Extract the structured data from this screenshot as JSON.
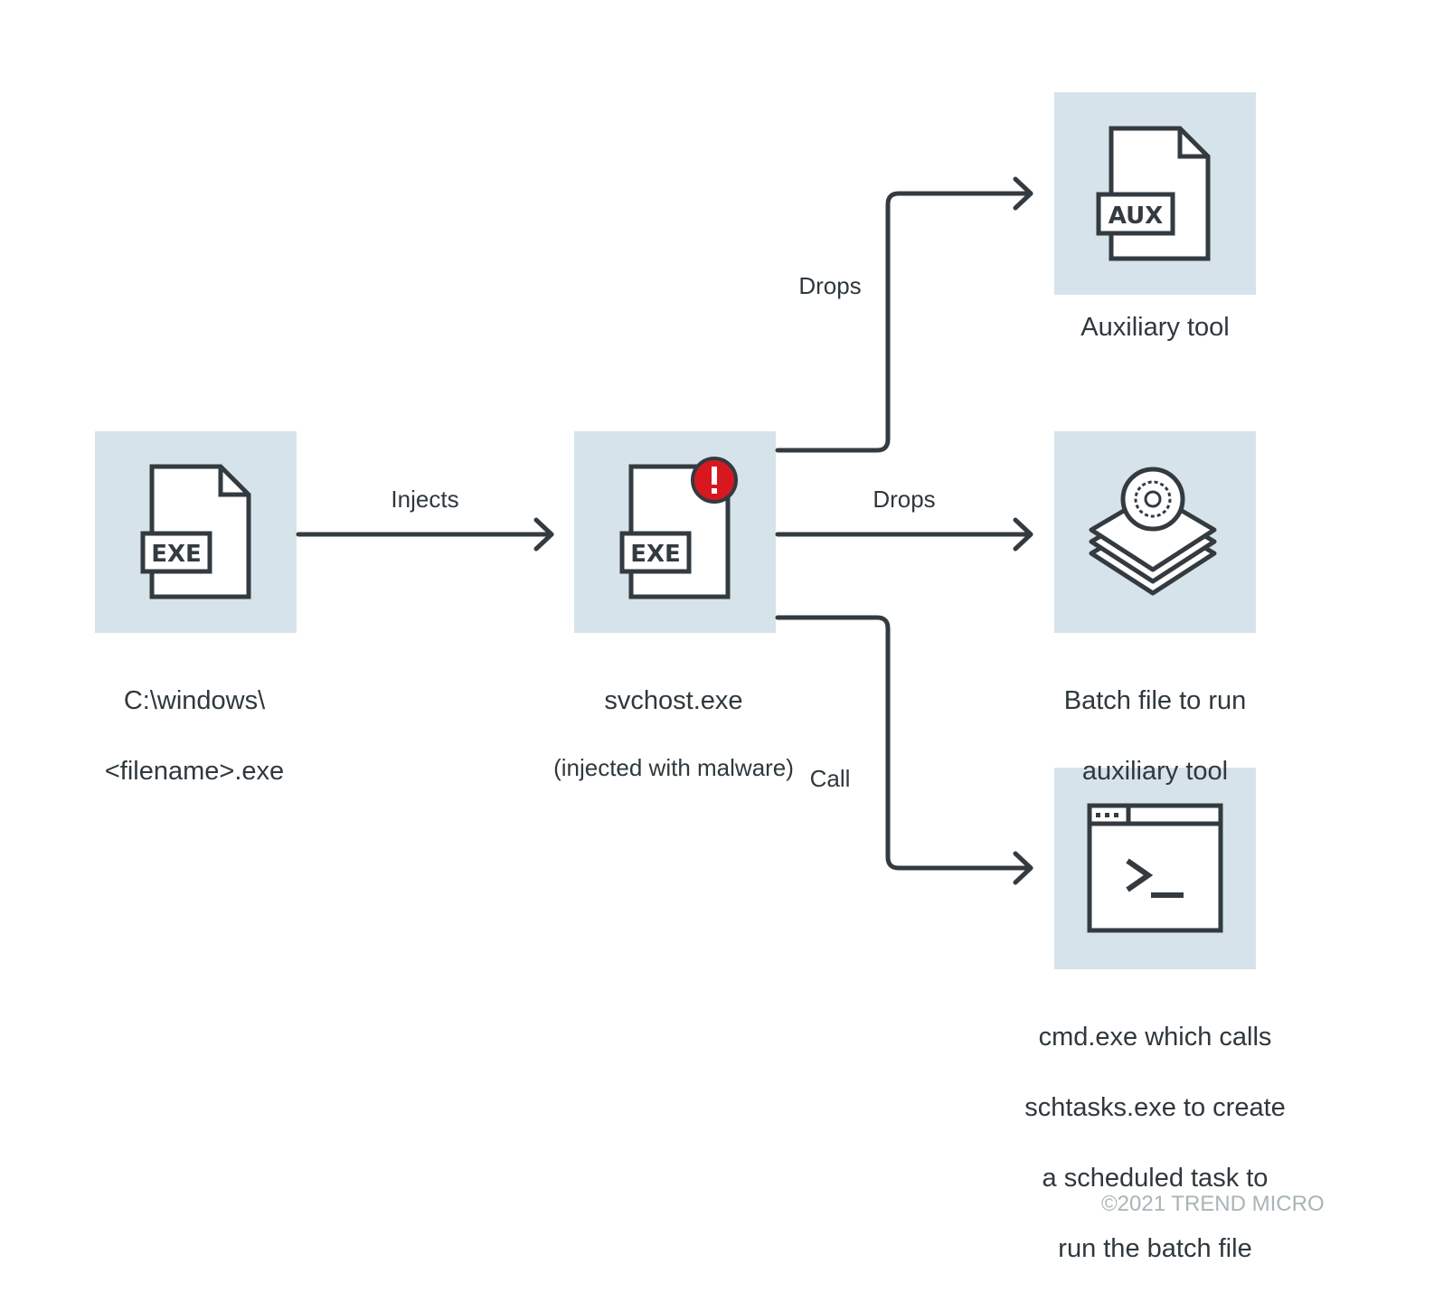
{
  "colors": {
    "box": "#d6e3ea",
    "stroke": "#333b40",
    "alert": "#d7191f",
    "copyright": "#a9b4b7"
  },
  "nodes": {
    "source": {
      "label_line1": "C:\\windows\\",
      "label_line2": "<filename>.exe",
      "badge": "EXE",
      "icon": "exe-file-icon"
    },
    "svchost": {
      "label": "svchost.exe",
      "sublabel": "(injected with malware)",
      "badge": "EXE",
      "icon": "exe-file-alert-icon"
    },
    "aux": {
      "label": "Auxiliary tool",
      "badge": "AUX",
      "icon": "aux-file-icon"
    },
    "batch": {
      "label_line1": "Batch file to run",
      "label_line2": "auxiliary tool",
      "icon": "stacked-gear-icon"
    },
    "cmd": {
      "label_lines": [
        "cmd.exe which calls",
        "schtasks.exe to create",
        "a scheduled task to",
        "run the batch file"
      ],
      "icon": "terminal-window-icon"
    }
  },
  "edges": {
    "injects": "Injects",
    "drops_aux": "Drops",
    "drops_batch": "Drops",
    "call": "Call"
  },
  "footer": {
    "copyright": "©2021 TREND MICRO"
  }
}
